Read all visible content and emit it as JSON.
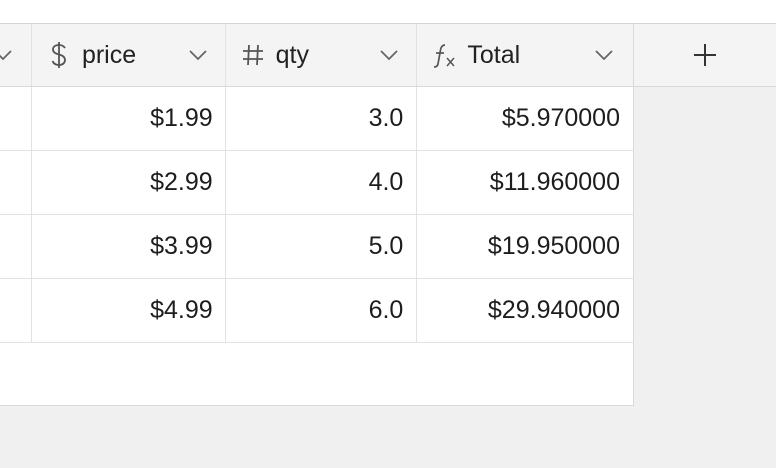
{
  "columns": [
    {
      "name": "",
      "icon": "chevron-down-icon"
    },
    {
      "name": "price",
      "icon": "dollar-icon"
    },
    {
      "name": "qty",
      "icon": "hash-icon"
    },
    {
      "name": "Total",
      "icon": "formula-icon"
    }
  ],
  "add_column": {
    "icon": "plus-icon"
  },
  "rows": [
    {
      "price": "$1.99",
      "qty": "3.0",
      "total": "$5.970000"
    },
    {
      "price": "$2.99",
      "qty": "4.0",
      "total": "$11.960000"
    },
    {
      "price": "$3.99",
      "qty": "5.0",
      "total": "$19.950000"
    },
    {
      "price": "$4.99",
      "qty": "6.0",
      "total": "$29.940000"
    }
  ],
  "colors": {
    "header_bg": "#f4f4f4",
    "background": "#f0f0f0",
    "grid_bg": "#ffffff"
  }
}
